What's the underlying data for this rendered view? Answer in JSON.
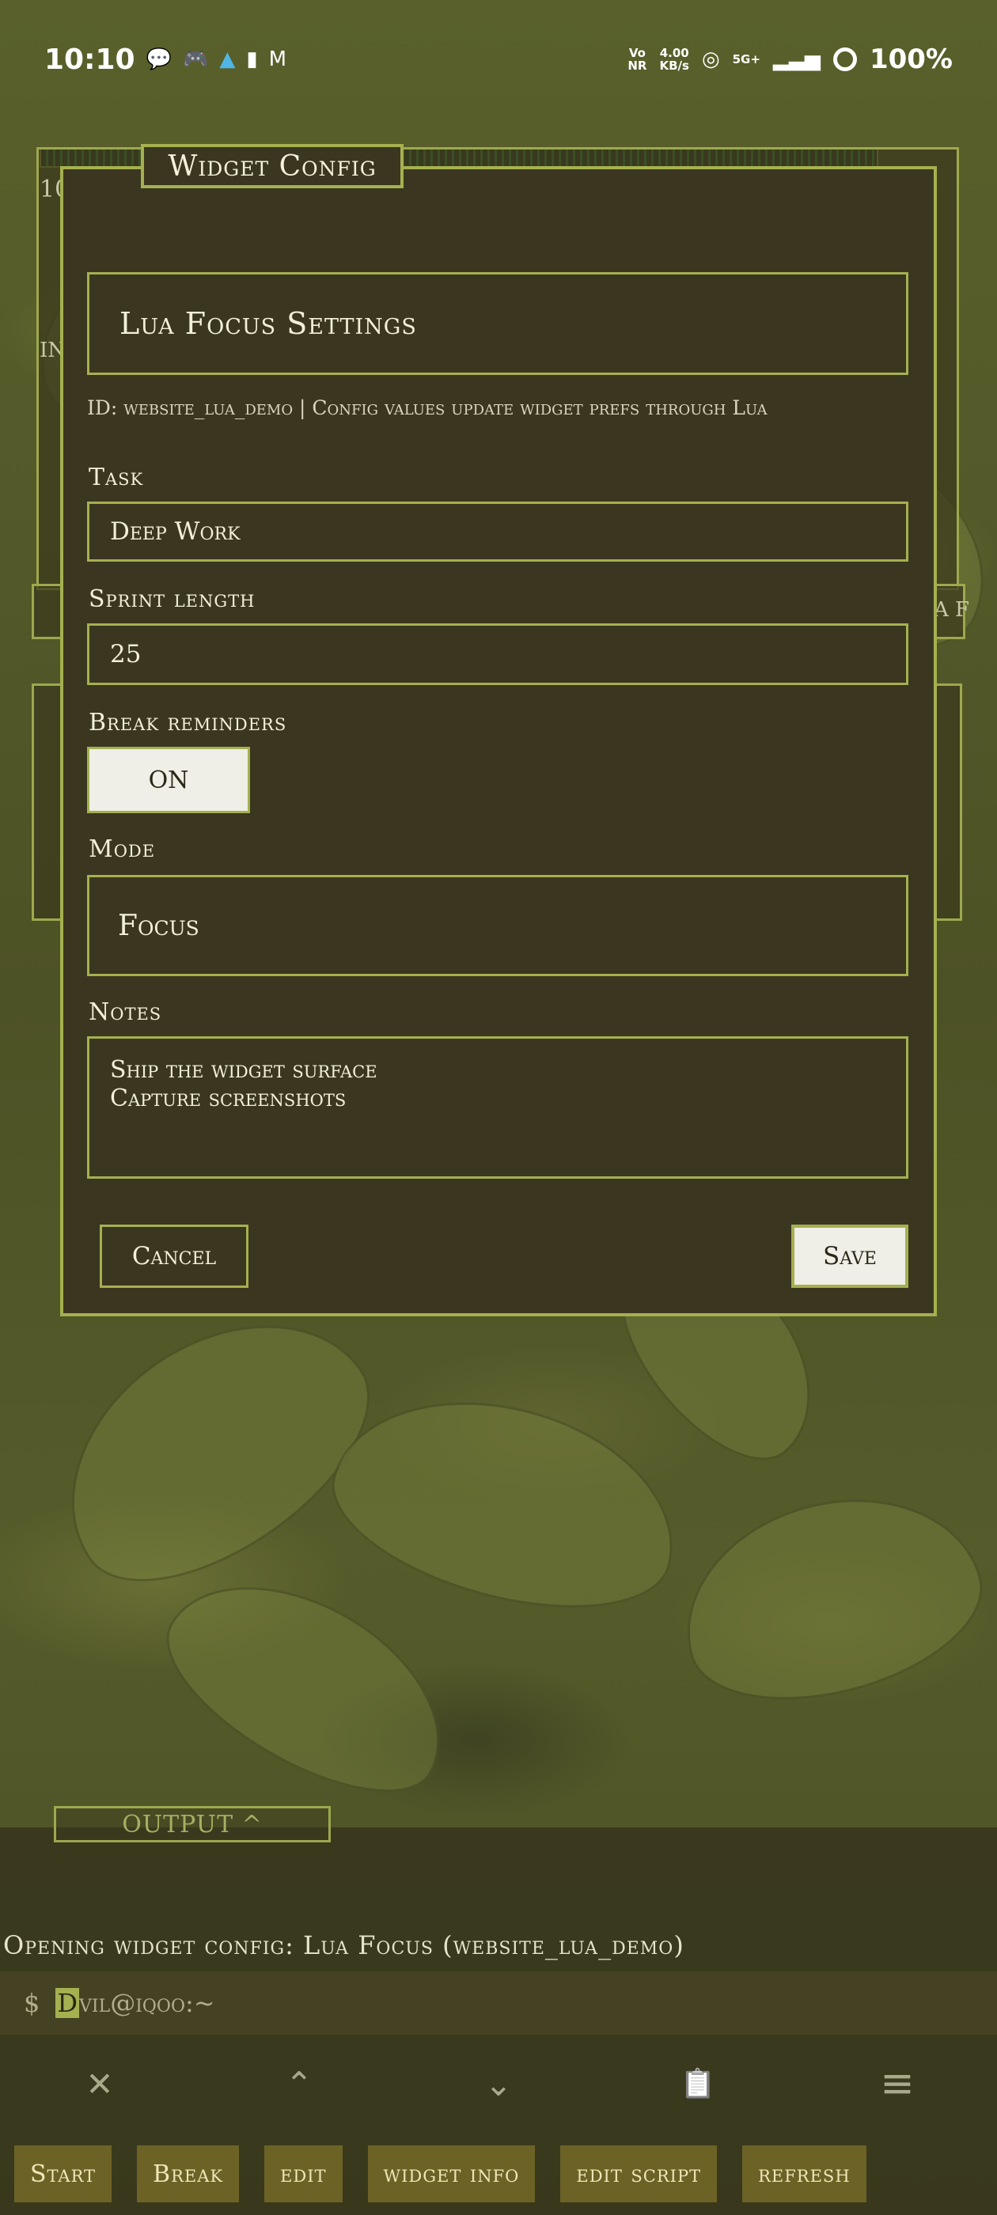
{
  "status_bar": {
    "time": "10:10",
    "network_top": "Vo",
    "network_bottom": "NR",
    "speed_value": "4.00",
    "speed_unit": "KB/s",
    "signal": "5G+",
    "battery": "100%"
  },
  "background": {
    "peek_number": "10",
    "peek_text_a": "IN",
    "peek_text_b": "A F"
  },
  "dialog": {
    "tab_title": "Widget Config",
    "section_title": "Lua Focus Settings",
    "meta": "ID: website_lua_demo  |  Config values update widget prefs through Lua",
    "fields": {
      "task_label": "Task",
      "task_value": "Deep Work",
      "sprint_label": "Sprint length",
      "sprint_value": "25",
      "break_label": "Break reminders",
      "break_value": "ON",
      "mode_label": "Mode",
      "mode_value": "Focus",
      "notes_label": "Notes",
      "notes_value": "Ship the widget surface\nCapture screenshots"
    },
    "cancel_label": "Cancel",
    "save_label": "Save"
  },
  "terminal": {
    "output_tab": "OUTPUT ^",
    "message": "Opening widget config: Lua Focus (website_lua_demo)",
    "prompt_symbol": "$",
    "prompt_cursor": "D",
    "prompt_text": "vil@iqoo:~"
  },
  "extra_keys": {
    "close": "✕",
    "up": "⌃",
    "down": "⌄",
    "clipboard": "📋",
    "menu": "≡"
  },
  "actions": [
    "Start",
    "Break",
    "edit",
    "widget info",
    "edit script",
    "refresh"
  ],
  "colors": {
    "accent": "#a5b050",
    "dialog_bg": "#3b3620",
    "action_bg": "#6c6226"
  }
}
